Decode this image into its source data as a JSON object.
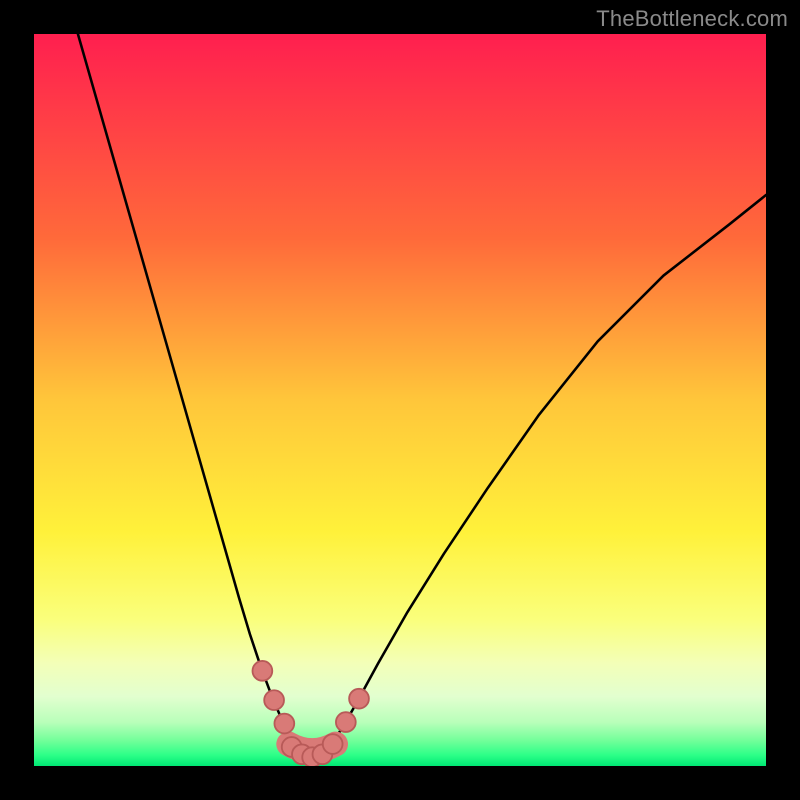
{
  "watermark": "TheBottleneck.com",
  "colors": {
    "frame": "#000000",
    "gradient_stops": [
      {
        "pos": 0.0,
        "color": "#ff1f4f"
      },
      {
        "pos": 0.28,
        "color": "#ff6a3a"
      },
      {
        "pos": 0.5,
        "color": "#ffc63a"
      },
      {
        "pos": 0.68,
        "color": "#fff13a"
      },
      {
        "pos": 0.8,
        "color": "#faff7c"
      },
      {
        "pos": 0.86,
        "color": "#f3ffb8"
      },
      {
        "pos": 0.905,
        "color": "#e2ffcf"
      },
      {
        "pos": 0.94,
        "color": "#b9ffba"
      },
      {
        "pos": 0.965,
        "color": "#73ff9a"
      },
      {
        "pos": 0.985,
        "color": "#2dff88"
      },
      {
        "pos": 1.0,
        "color": "#00e874"
      }
    ],
    "curve": "#000000",
    "marker_fill": "#d97a77",
    "marker_stroke": "#b85a58"
  },
  "chart_data": {
    "type": "line",
    "title": "",
    "xlabel": "",
    "ylabel": "",
    "xlim": [
      0,
      100
    ],
    "ylim": [
      0,
      100
    ],
    "series": [
      {
        "name": "left-branch",
        "x": [
          6,
          10,
          14,
          18,
          22,
          24,
          26,
          28,
          29.5,
          31,
          32.5,
          34,
          35.5,
          37,
          38
        ],
        "y": [
          100,
          86,
          72,
          58,
          44,
          37,
          30,
          23,
          18,
          13.5,
          9.5,
          6,
          3.5,
          1.8,
          1.0
        ]
      },
      {
        "name": "right-branch",
        "x": [
          38,
          39,
          40.5,
          42,
          44,
          47,
          51,
          56,
          62,
          69,
          77,
          86,
          95,
          100
        ],
        "y": [
          1.0,
          1.6,
          3.0,
          5.0,
          8.5,
          14,
          21,
          29,
          38,
          48,
          58,
          67,
          74,
          78
        ]
      }
    ],
    "markers": [
      {
        "name": "cluster-left-1",
        "x": 31.2,
        "y": 13.0
      },
      {
        "name": "cluster-left-2",
        "x": 32.8,
        "y": 9.0
      },
      {
        "name": "cluster-left-3",
        "x": 34.2,
        "y": 5.8
      },
      {
        "name": "trough-1",
        "x": 35.2,
        "y": 2.6
      },
      {
        "name": "trough-2",
        "x": 36.6,
        "y": 1.6
      },
      {
        "name": "trough-3",
        "x": 38.0,
        "y": 1.2
      },
      {
        "name": "trough-4",
        "x": 39.4,
        "y": 1.6
      },
      {
        "name": "trough-5",
        "x": 40.8,
        "y": 3.0
      },
      {
        "name": "cluster-right-1",
        "x": 42.6,
        "y": 6.0
      },
      {
        "name": "cluster-right-2",
        "x": 44.4,
        "y": 9.2
      }
    ],
    "trough_strip": {
      "x_start": 34.8,
      "x_end": 41.2,
      "y": 1.8,
      "thickness": 3.4
    }
  }
}
